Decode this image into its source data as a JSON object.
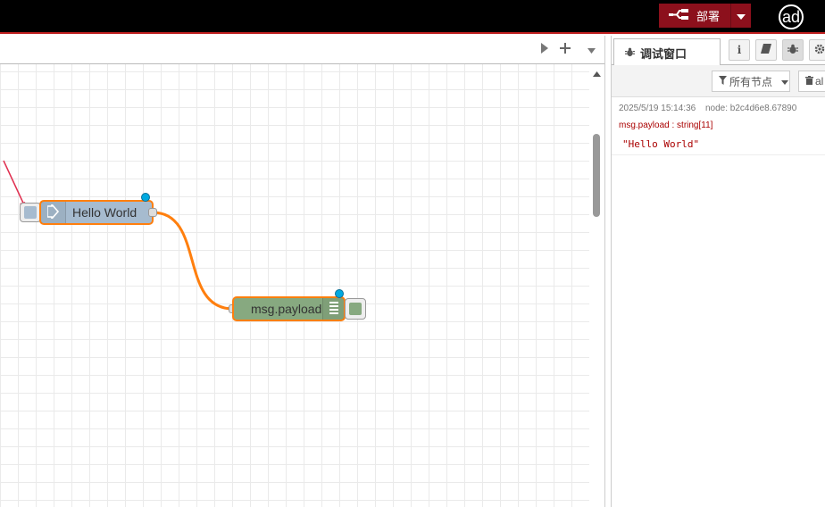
{
  "header": {
    "deploy_label": "部署",
    "avatar_text": "ad"
  },
  "flow": {
    "nodes": [
      {
        "label": "Hello World",
        "type": "inject",
        "color": "#a6bbcf"
      },
      {
        "label": "msg.payload",
        "type": "debug",
        "color": "#87a980"
      }
    ]
  },
  "sidebar": {
    "active_tab": "调试窗口",
    "filter_label": "所有节点",
    "clear_label": "al",
    "messages": [
      {
        "timestamp": "2025/5/19 15:14:36",
        "node": "node: b2c4d6e8.67890",
        "topic": "msg.payload : string[11]",
        "value": "\"Hello World\""
      }
    ]
  },
  "colors": {
    "header_bg": "#000000",
    "deploy_bg": "#8c101c",
    "node_selected_border": "#ff7f0e",
    "wire": "#ff7f0e",
    "status_dot": "#00a9e0",
    "debug_text": "#aa0000"
  },
  "icons": [
    "deploy-icon",
    "chevron-down-icon",
    "play-icon",
    "plus-icon",
    "bug-icon",
    "info-icon",
    "book-icon",
    "gear-icon",
    "filter-icon",
    "trash-icon",
    "arrow-right-icon",
    "list-icon"
  ]
}
